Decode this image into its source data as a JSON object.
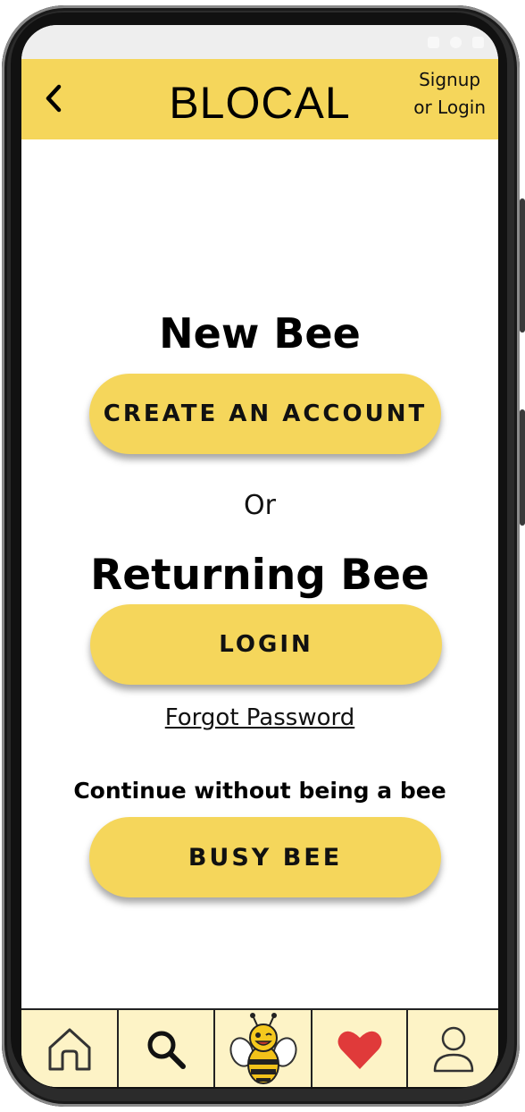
{
  "header": {
    "title": "BLOCAL",
    "signup_line1": "Signup",
    "signup_line2": "or Login",
    "back_icon": "chevron-left-icon"
  },
  "main": {
    "new_heading": "New Bee",
    "create_button": "CREATE AN ACCOUNT",
    "or_text": "Or",
    "returning_heading": "Returning Bee",
    "login_button": "LOGIN",
    "forgot_link": "Forgot Password",
    "continue_text": "Continue without being a bee",
    "busy_button": "BUSY BEE"
  },
  "bottom_nav": {
    "items": [
      {
        "icon": "home-icon"
      },
      {
        "icon": "search-icon"
      },
      {
        "icon": "bee-mascot-icon"
      },
      {
        "icon": "heart-icon"
      },
      {
        "icon": "profile-icon"
      }
    ]
  },
  "colors": {
    "accent": "#f5d65b",
    "nav_background": "#fdf3c6",
    "heart": "#e03a3a"
  }
}
